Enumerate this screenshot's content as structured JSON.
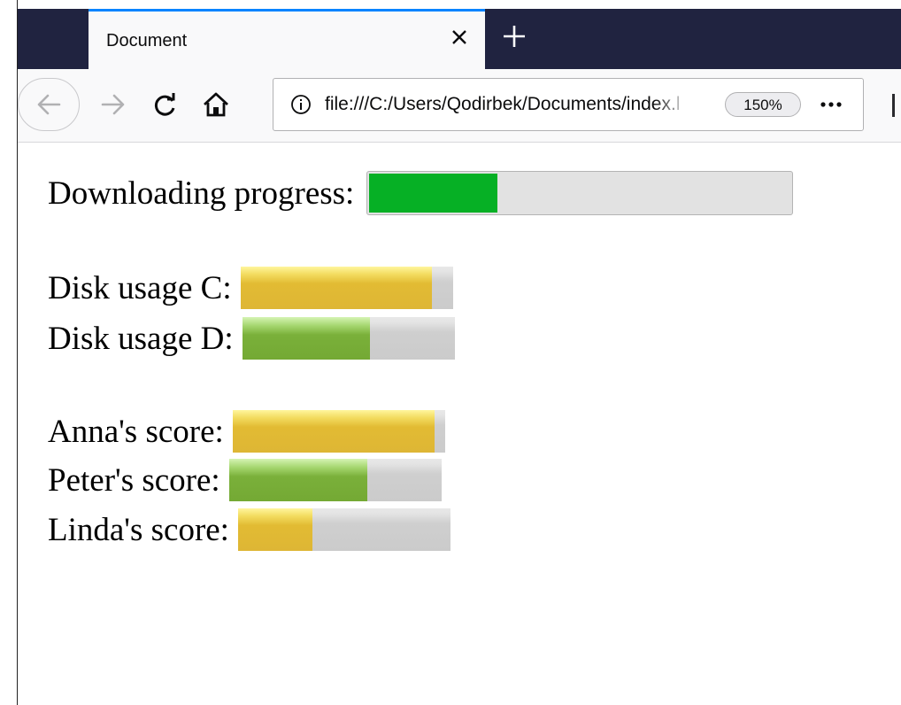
{
  "tab": {
    "title": "Document"
  },
  "navbar": {
    "url": "file:///C:/Users/Qodirbek/Documents/index.html",
    "zoom": "150%"
  },
  "content": {
    "download": {
      "label": "Downloading progress:",
      "value": 0.31
    },
    "disks": [
      {
        "label": "Disk usage C:",
        "value": 0.9,
        "color": "yellow"
      },
      {
        "label": "Disk usage D:",
        "value": 0.6,
        "color": "green"
      }
    ],
    "scores": [
      {
        "label": "Anna's score:",
        "value": 0.95,
        "color": "yellow"
      },
      {
        "label": "Peter's score:",
        "value": 0.65,
        "color": "green"
      },
      {
        "label": "Linda's score:",
        "value": 0.35,
        "color": "yellow"
      }
    ]
  },
  "colors": {
    "tabstrip": "#202340",
    "tab_accent": "#0a84ff",
    "progress_green": "#06b025",
    "meter_yellow": "#e2bb33",
    "meter_green": "#7ab03a"
  }
}
